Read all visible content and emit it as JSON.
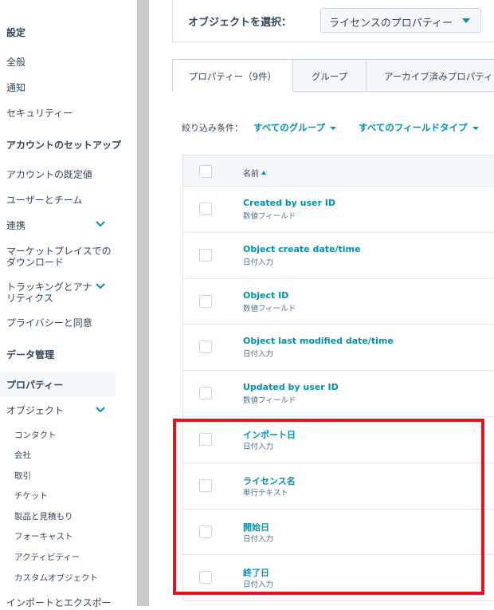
{
  "sidebar": {
    "settings_title": "設定",
    "general": "全般",
    "notifications": "通知",
    "security": "セキュリティー",
    "account_setup_title": "アカウントのセットアップ",
    "account_defaults": "アカウントの既定値",
    "users_teams": "ユーザーとチーム",
    "integrations": "連携",
    "marketplace_downloads_line1": "マーケットプレイスでの",
    "marketplace_downloads_line2": "ダウンロード",
    "tracking_analytics_line1": "トラッキングとアナ",
    "tracking_analytics_line2": "リティクス",
    "privacy_consent": "プライバシーと同意",
    "data_management_title": "データ管理",
    "properties": "プロパティー",
    "objects": "オブジェクト",
    "object_items": [
      "コンタクト",
      "会社",
      "取引",
      "チケット",
      "製品と見積もり",
      "フォーキャスト",
      "アクティビティー",
      "カスタムオブジェクト"
    ],
    "import_export": "インポートとエクスポー"
  },
  "object_select": {
    "label": "オブジェクトを選択：",
    "value": "ライセンスのプロパティー"
  },
  "tabs": [
    {
      "label": "プロパティー（9件）"
    },
    {
      "label": "グループ"
    },
    {
      "label": "アーカイブ済みプロパティー"
    }
  ],
  "filters": {
    "label": "絞り込み条件：",
    "group": "すべてのグループ",
    "field_type": "すべてのフィールドタイプ"
  },
  "table": {
    "header_name": "名前",
    "rows": [
      {
        "name": "Created by user ID",
        "type": "数値フィールド"
      },
      {
        "name": "Object create date/time",
        "type": "日付入力"
      },
      {
        "name": "Object ID",
        "type": "数値フィールド"
      },
      {
        "name": "Object last modified date/time",
        "type": "日付入力"
      },
      {
        "name": "Updated by user ID",
        "type": "数値フィールド"
      },
      {
        "name": "インポート日",
        "type": "日付入力"
      },
      {
        "name": "ライセンス名",
        "type": "単行テキスト"
      },
      {
        "name": "開始日",
        "type": "日付入力"
      },
      {
        "name": "終了日",
        "type": "日付入力"
      }
    ]
  },
  "colors": {
    "accent": "#0091ae",
    "text": "#33475b",
    "highlight_border": "#e0141e"
  }
}
